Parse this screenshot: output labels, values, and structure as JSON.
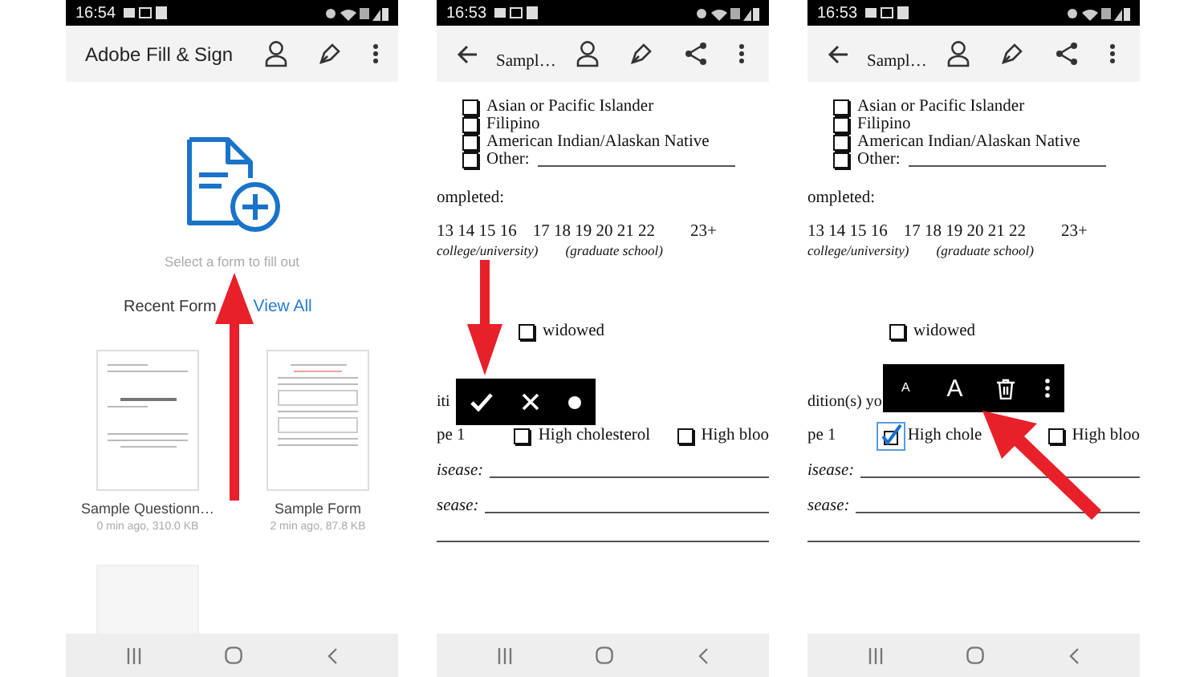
{
  "screens": [
    {
      "kind": "home",
      "status_time": "16:54",
      "title": "Adobe Fill & Sign",
      "empty_prompt": "Select a form to fill out",
      "recent_label": "Recent Form",
      "view_all": "View All",
      "forms": [
        {
          "kind": "questionnaire",
          "name": "Sample Questionn…",
          "meta": "0 min ago, 310.0 KB"
        },
        {
          "kind": "form",
          "name": "Sample Form",
          "meta": "2 min ago, 87.8 KB"
        },
        {
          "kind": "blank"
        }
      ]
    },
    {
      "kind": "document",
      "status_time": "16:53",
      "title": "Sampl…",
      "rows": [
        {
          "kind": "option",
          "cells": [
            {
              "kind": "checkbox",
              "label": "Asian or Pacific Islander",
              "checked": false
            }
          ]
        },
        {
          "kind": "option",
          "cells": [
            {
              "kind": "checkbox",
              "label": "Filipino",
              "checked": false
            }
          ]
        },
        {
          "kind": "option",
          "cells": [
            {
              "kind": "checkbox",
              "label": "American Indian/Alaskan Native",
              "checked": false
            }
          ]
        },
        {
          "kind": "option",
          "cells": [
            {
              "kind": "checkbox",
              "label": "Other:",
              "checked": false,
              "blank": true
            }
          ]
        },
        {
          "kind": "heading",
          "cells": [
            {
              "kind": "text",
              "text": "ompleted:"
            }
          ]
        },
        {
          "kind": "grades",
          "cells": [
            {
              "kind": "text",
              "text": "13 14 15 16"
            },
            {
              "kind": "text",
              "text": "17 18 19 20 21 22"
            },
            {
              "kind": "text",
              "text": "23+"
            }
          ]
        },
        {
          "kind": "notes",
          "cells": [
            {
              "kind": "text",
              "text": "college/university)"
            },
            {
              "kind": "text",
              "text": "(graduate school)"
            }
          ]
        },
        {
          "kind": "offset",
          "cells": [
            {
              "kind": "checkbox",
              "label": "widowed",
              "checked": false
            }
          ]
        },
        {
          "kind": "caption",
          "cells": [
            {
              "kind": "text",
              "text": "iti"
            }
          ]
        },
        {
          "kind": "choices",
          "cells": [
            {
              "kind": "text",
              "text": "pe 1"
            },
            {
              "kind": "checkbox",
              "label": "High cholesterol",
              "checked": false
            },
            {
              "kind": "checkbox",
              "label": "High bloo",
              "checked": false
            }
          ]
        },
        {
          "kind": "field",
          "cells": [
            {
              "kind": "text",
              "text": "isease:"
            }
          ]
        },
        {
          "kind": "field",
          "cells": [
            {
              "kind": "text",
              "text": "sease:"
            }
          ]
        },
        {
          "kind": "rule",
          "cells": []
        }
      ],
      "toolbar": {
        "kind": "mark",
        "items": [
          {
            "kind": "check"
          },
          {
            "kind": "cross"
          },
          {
            "kind": "dot"
          }
        ]
      }
    },
    {
      "kind": "document",
      "status_time": "16:53",
      "title": "Sampl…",
      "rows": [
        {
          "kind": "option",
          "cells": [
            {
              "kind": "checkbox",
              "label": "Asian or Pacific Islander",
              "checked": false
            }
          ]
        },
        {
          "kind": "option",
          "cells": [
            {
              "kind": "checkbox",
              "label": "Filipino",
              "checked": false
            }
          ]
        },
        {
          "kind": "option",
          "cells": [
            {
              "kind": "checkbox",
              "label": "American Indian/Alaskan Native",
              "checked": false
            }
          ]
        },
        {
          "kind": "option",
          "cells": [
            {
              "kind": "checkbox",
              "label": "Other:",
              "checked": false,
              "blank": true
            }
          ]
        },
        {
          "kind": "heading",
          "cells": [
            {
              "kind": "text",
              "text": "ompleted:"
            }
          ]
        },
        {
          "kind": "grades",
          "cells": [
            {
              "kind": "text",
              "text": "13 14 15 16"
            },
            {
              "kind": "text",
              "text": "17 18 19 20 21 22"
            },
            {
              "kind": "text",
              "text": "23+"
            }
          ]
        },
        {
          "kind": "notes",
          "cells": [
            {
              "kind": "text",
              "text": "college/university)"
            },
            {
              "kind": "text",
              "text": "(graduate school)"
            }
          ]
        },
        {
          "kind": "offset",
          "cells": [
            {
              "kind": "checkbox",
              "label": "widowed",
              "checked": false
            }
          ]
        },
        {
          "kind": "caption",
          "cells": [
            {
              "kind": "text",
              "text": "dition(s) yo"
            }
          ]
        },
        {
          "kind": "choices",
          "cells": [
            {
              "kind": "text",
              "text": "pe 1"
            },
            {
              "kind": "checkbox",
              "label": "High chole",
              "checked": true
            },
            {
              "kind": "checkbox",
              "label": "High bloo",
              "checked": false
            }
          ]
        },
        {
          "kind": "field",
          "cells": [
            {
              "kind": "text",
              "text": "isease:"
            }
          ]
        },
        {
          "kind": "field",
          "cells": [
            {
              "kind": "text",
              "text": "sease:"
            }
          ]
        },
        {
          "kind": "rule",
          "cells": []
        }
      ],
      "toolbar": {
        "kind": "text",
        "items": [
          {
            "kind": "small-letter",
            "text": "A"
          },
          {
            "kind": "large-letter",
            "text": "A"
          },
          {
            "kind": "trash"
          },
          {
            "kind": "more"
          }
        ]
      }
    }
  ]
}
